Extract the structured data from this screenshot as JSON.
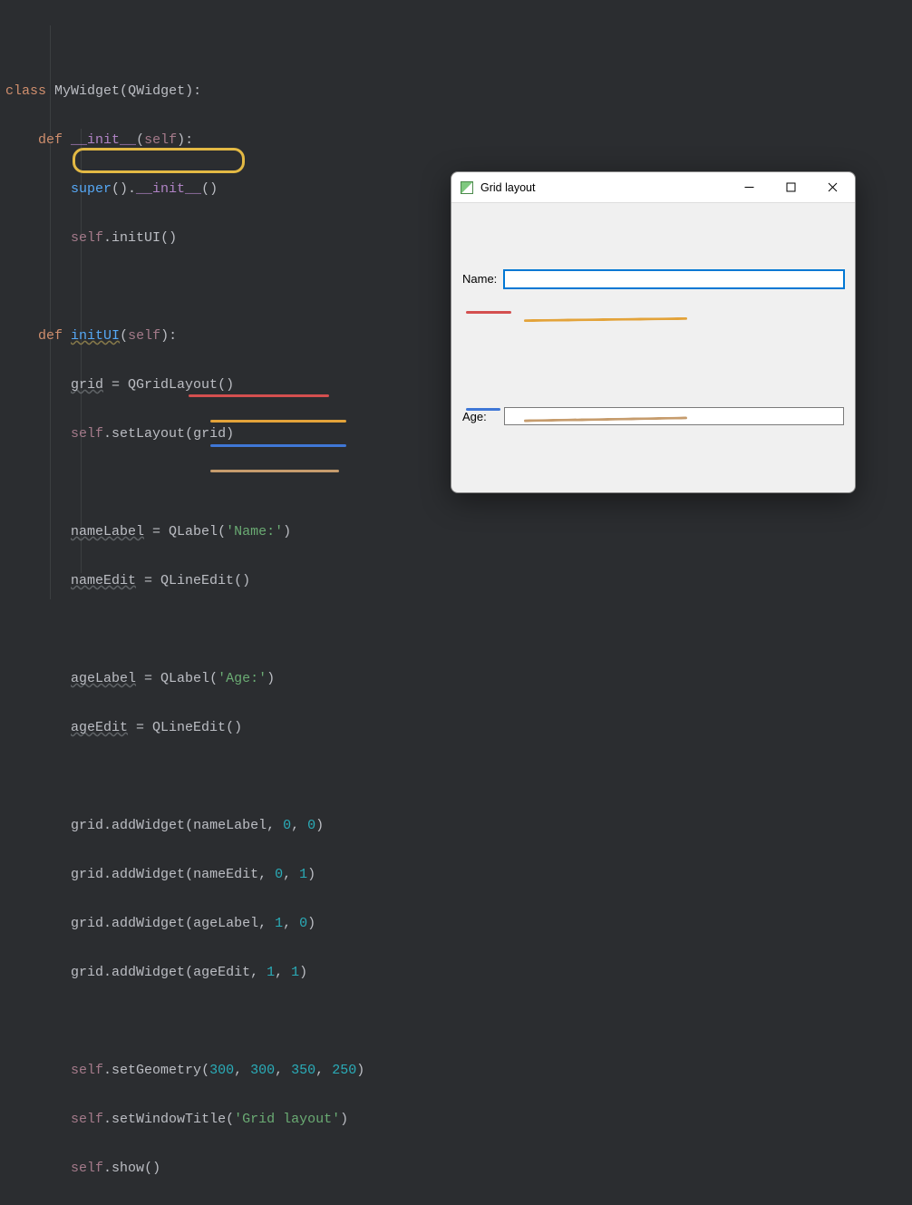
{
  "code": {
    "l1_class": "class",
    "l1_name": "MyWidget",
    "l1_base": "QWidget",
    "l2_def": "def",
    "l2_fn": "__init__",
    "l2_self": "self",
    "l3_super": "super",
    "l3_init": "__init__",
    "l4_self": "self",
    "l4_initUI": "initUI",
    "l6_def": "def",
    "l6_fn": "initUI",
    "l6_self": "self",
    "l7_grid": "grid",
    "l7_eq": " = ",
    "l7_ctor": "QGridLayout",
    "l8_self": "self",
    "l8_setLayout": "setLayout",
    "l8_arg": "grid",
    "l10_nameLabel": "nameLabel",
    "l10_eq": " = ",
    "l10_QLabel": "QLabel",
    "l10_str": "'Name:'",
    "l11_nameEdit": "nameEdit",
    "l11_eq": " = ",
    "l11_QLineEdit": "QLineEdit",
    "l13_ageLabel": "ageLabel",
    "l13_eq": " = ",
    "l13_QLabel": "QLabel",
    "l13_str": "'Age:'",
    "l14_ageEdit": "ageEdit",
    "l14_eq": " = ",
    "l14_QLineEdit": "QLineEdit",
    "l16_grid": "grid",
    "l16_add": "addWidget",
    "l16_a": "nameLabel",
    "l16_b": "0",
    "l16_c": "0",
    "l17_grid": "grid",
    "l17_add": "addWidget",
    "l17_a": "nameEdit",
    "l17_b": "0",
    "l17_c": "1",
    "l18_grid": "grid",
    "l18_add": "addWidget",
    "l18_a": "ageLabel",
    "l18_b": "1",
    "l18_c": "0",
    "l19_grid": "grid",
    "l19_add": "addWidget",
    "l19_a": "ageEdit",
    "l19_b": "1",
    "l19_c": "1",
    "l21_self": "self",
    "l21_setGeo": "setGeometry",
    "l21_a": "300",
    "l21_b": "300",
    "l21_c": "350",
    "l21_d": "250",
    "l22_self": "self",
    "l22_setTitle": "setWindowTitle",
    "l22_str": "'Grid layout'",
    "l23_self": "self",
    "l23_show": "show"
  },
  "window": {
    "title": "Grid layout",
    "name_label": "Name:",
    "age_label": "Age:",
    "name_value": "",
    "age_value": ""
  }
}
